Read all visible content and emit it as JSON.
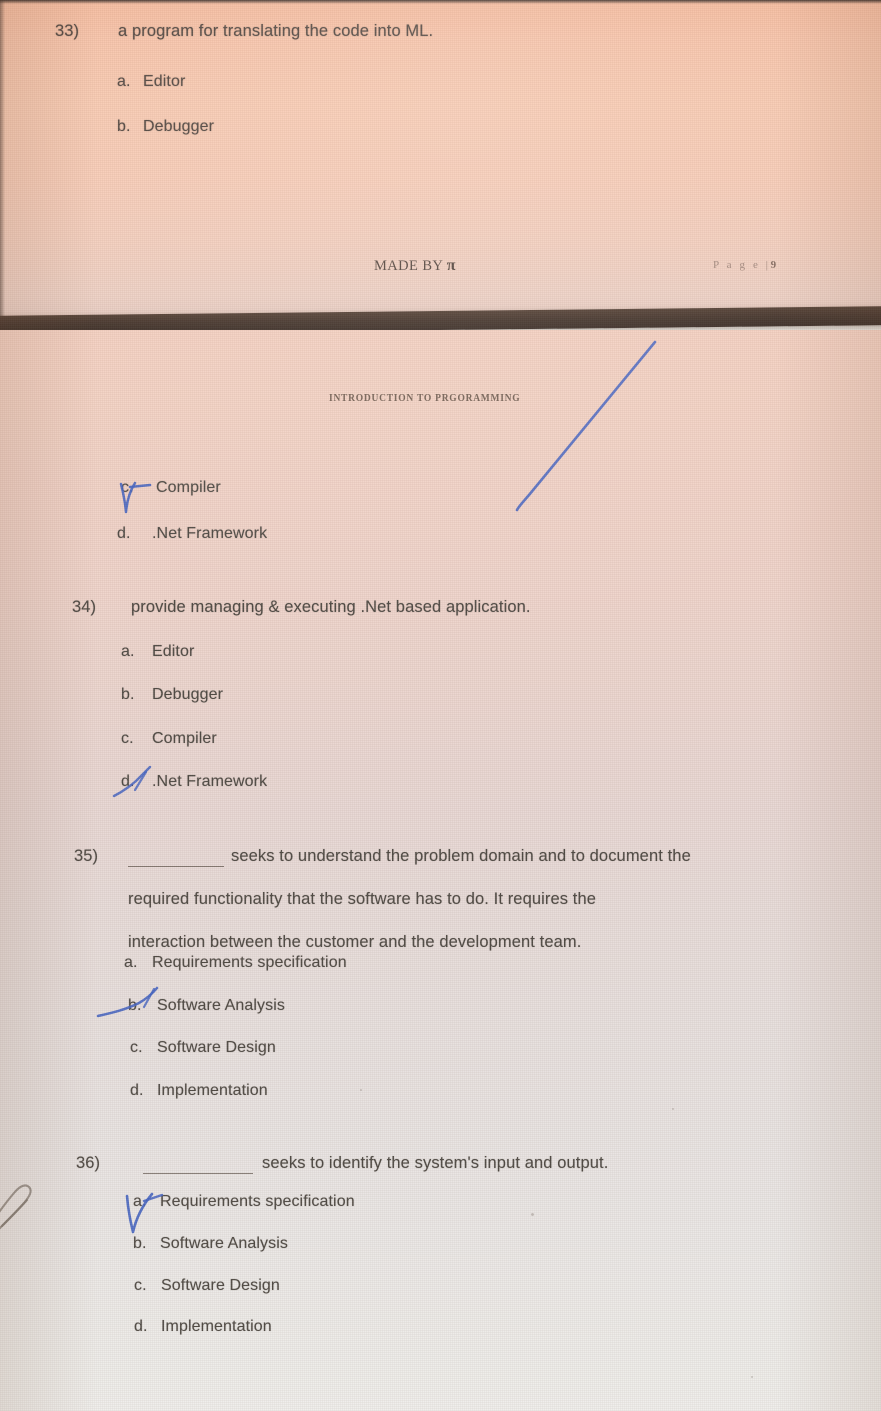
{
  "document": {
    "header_running_title": "INTRODUCTION TO PRGORAMMING",
    "footer_credit_prefix": "MADE BY",
    "footer_credit_symbol": "π",
    "footer_page_label": "P a g e  |",
    "footer_page_number": "9"
  },
  "colors": {
    "paper_warm": "#f6c6ac",
    "paper_cool": "#eceae7",
    "band_dark": "#33241b",
    "ink_blue": "#3f5fbf",
    "text_ink": "#463a33"
  },
  "questions": [
    {
      "number": "33)",
      "prompt": "a program for translating the code into ML.",
      "options": [
        {
          "label": "a.",
          "text": "Editor",
          "marked": false
        },
        {
          "label": "b.",
          "text": "Debugger",
          "marked": false
        },
        {
          "label": "c.",
          "text": "Compiler",
          "marked": true
        },
        {
          "label": "d.",
          "text": ".Net Framework",
          "marked": false
        }
      ],
      "selected_answer": "c. Compiler"
    },
    {
      "number": "34)",
      "prompt": "provide managing & executing .Net based application.",
      "options": [
        {
          "label": "a.",
          "text": "Editor",
          "marked": false
        },
        {
          "label": "b.",
          "text": "Debugger",
          "marked": false
        },
        {
          "label": "c.",
          "text": "Compiler",
          "marked": false
        },
        {
          "label": "d.",
          "text": ".Net Framework",
          "marked": true
        }
      ],
      "selected_answer": "d. .Net Framework"
    },
    {
      "number": "35)",
      "prompt_lines": [
        "seeks to understand the problem domain and to document the",
        "required functionality that the software has to do. It requires the",
        "interaction between the customer and the development team."
      ],
      "has_leading_blank": true,
      "options": [
        {
          "label": "a.",
          "text": "Requirements specification",
          "marked": false
        },
        {
          "label": "b.",
          "text": "Software Analysis",
          "marked": true
        },
        {
          "label": "c.",
          "text": "Software Design",
          "marked": false
        },
        {
          "label": "d.",
          "text": "Implementation",
          "marked": false
        }
      ],
      "selected_answer": "b. Software Analysis"
    },
    {
      "number": "36)",
      "prompt_lines": [
        "seeks to identify the system's input and output."
      ],
      "has_leading_blank": true,
      "options": [
        {
          "label": "a.",
          "text": "Requirements specification",
          "marked": true
        },
        {
          "label": "b.",
          "text": "Software Analysis",
          "marked": false
        },
        {
          "label": "c.",
          "text": "Software Design",
          "marked": false
        },
        {
          "label": "d.",
          "text": "Implementation",
          "marked": false
        }
      ],
      "selected_answer": "a. Requirements specification"
    }
  ]
}
